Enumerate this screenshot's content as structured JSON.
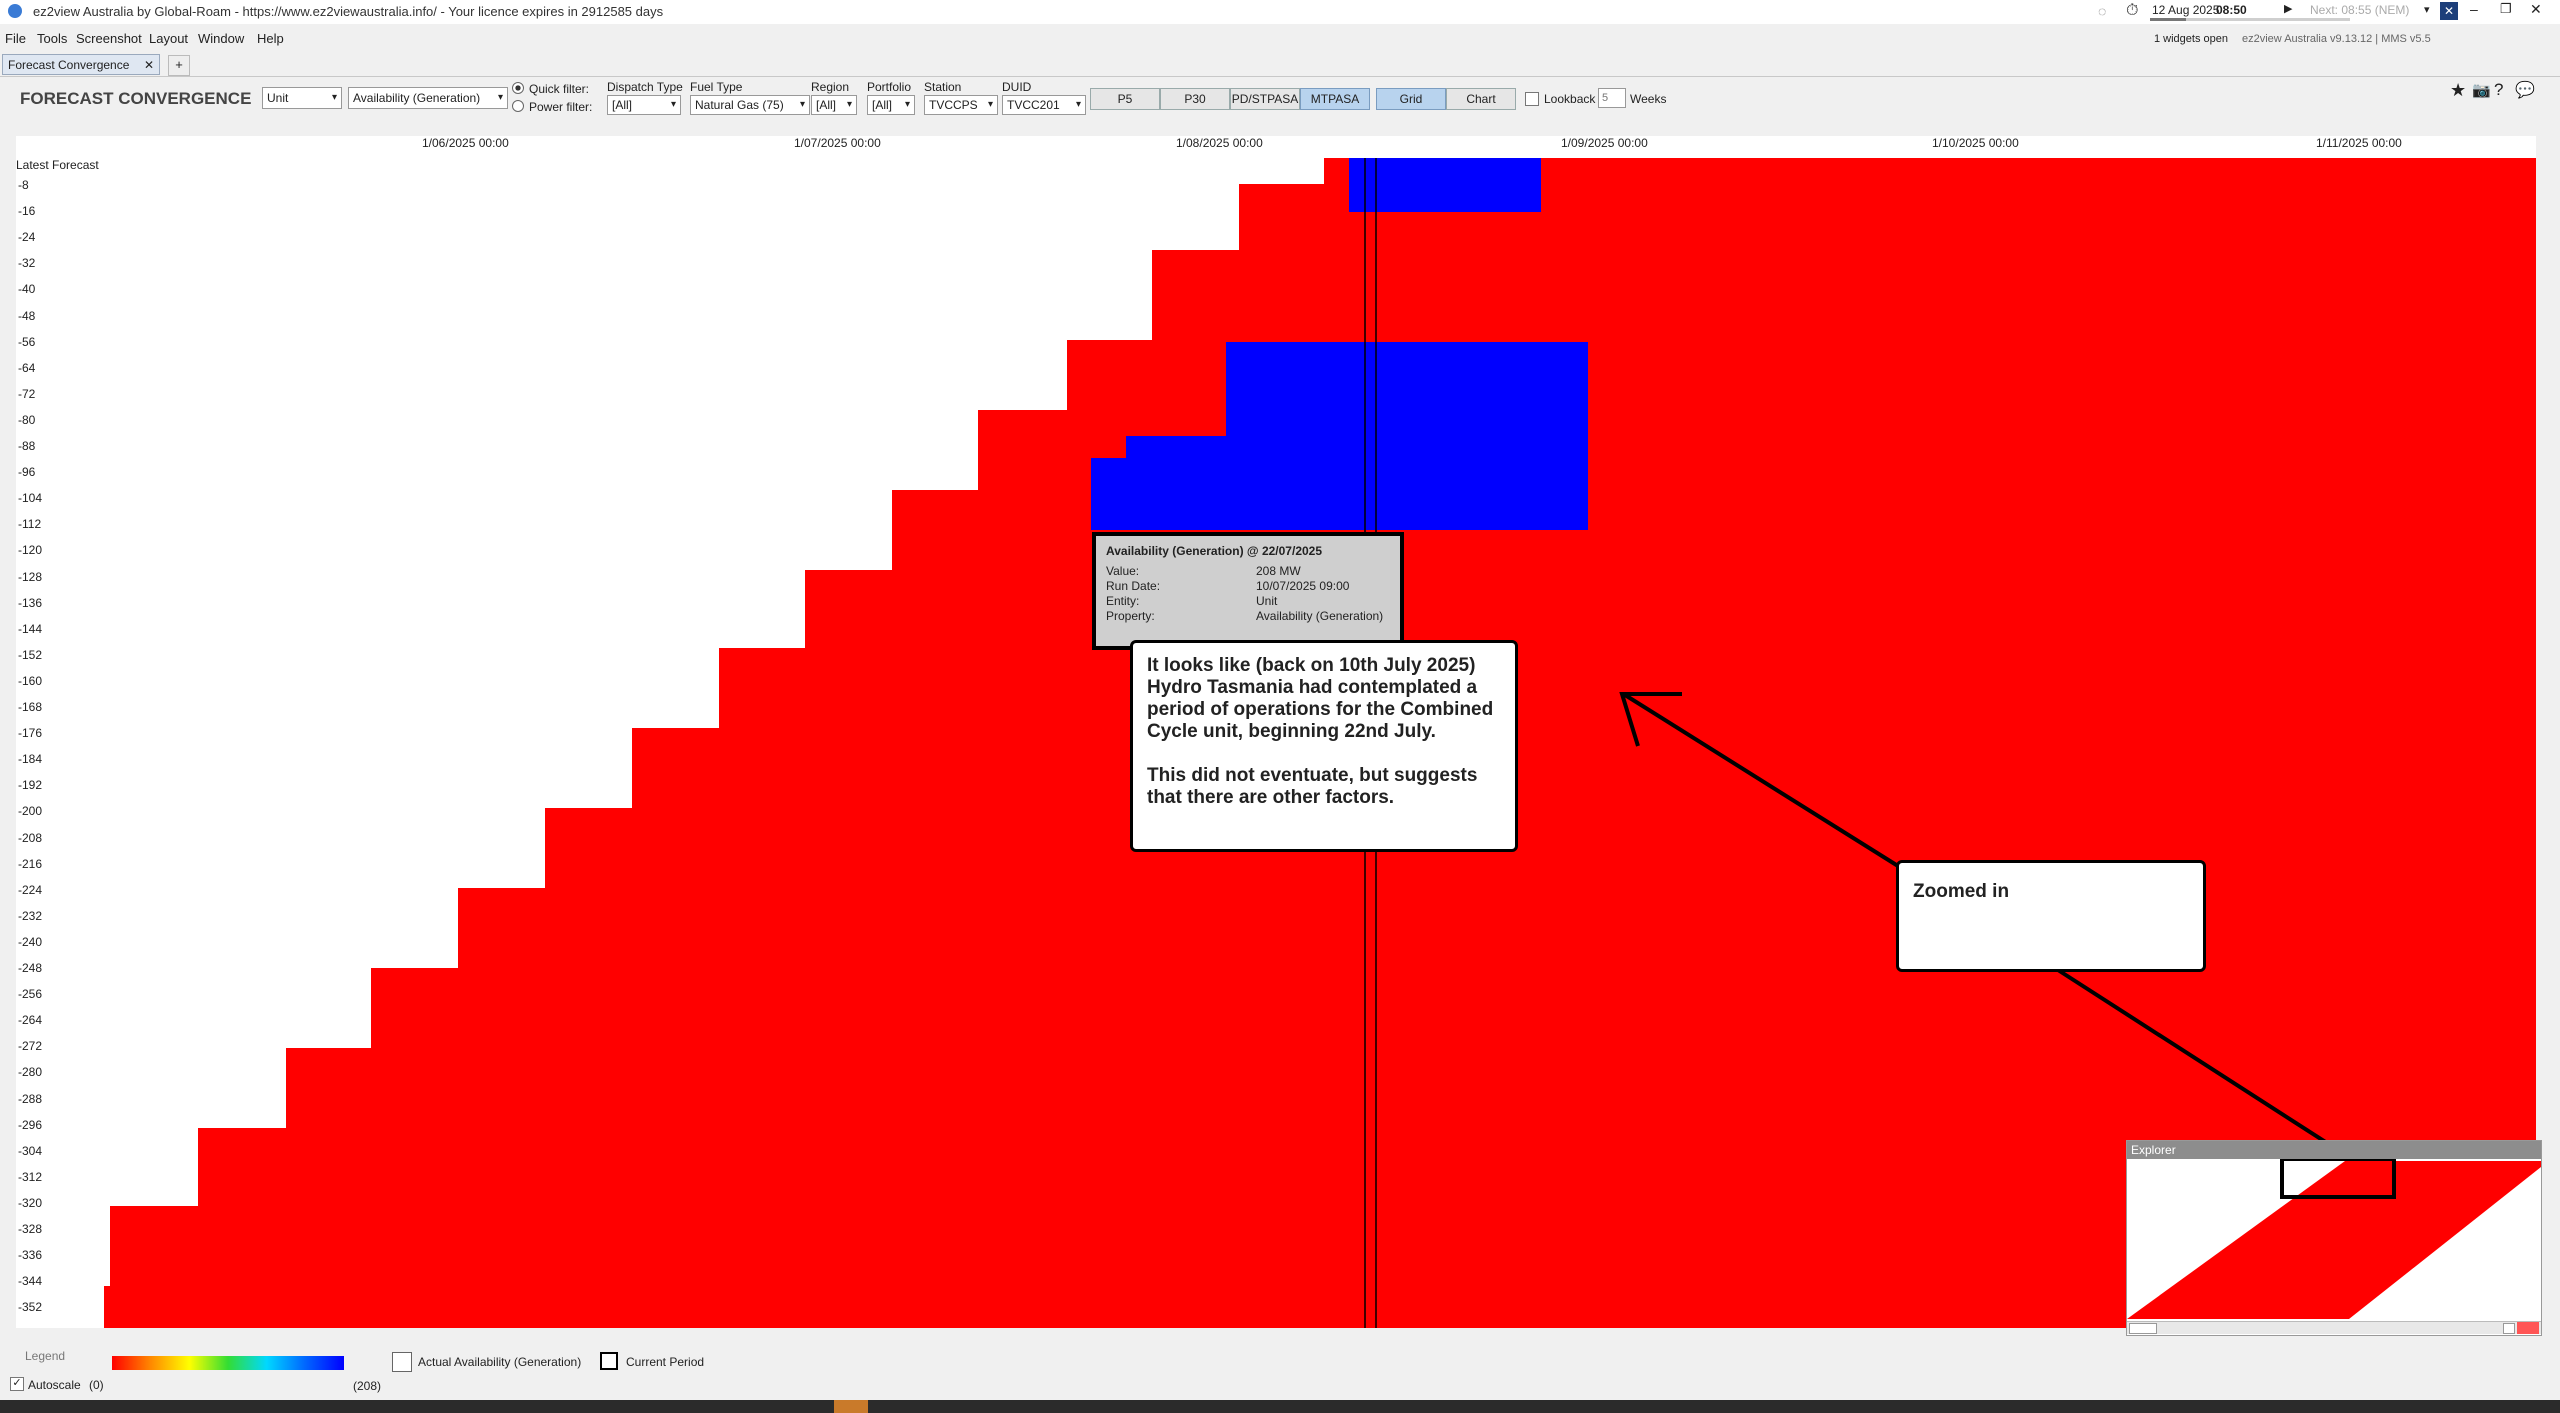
{
  "titlebar": {
    "title": "ez2view Australia by Global-Roam - https://www.ez2viewaustralia.info/ - Your licence expires in 2912585 days",
    "date": "12 Aug 2025",
    "time": "08:50",
    "next": "Next: 08:55 (NEM)",
    "widgets_open": "1 widgets open",
    "version": "ez2view Australia v9.13.12 | MMS v5.5"
  },
  "menu": [
    "File",
    "Tools",
    "Screenshot",
    "Layout",
    "Window",
    "Help"
  ],
  "tabs": [
    {
      "label": "Forecast Convergence"
    }
  ],
  "toolbar": {
    "title": "FORECAST CONVERGENCE",
    "unit_select": "Unit",
    "property_select": "Availability (Generation)",
    "quick_filter": "Quick filter:",
    "power_filter": "Power filter:",
    "dispatch_type_label": "Dispatch Type",
    "dispatch_type_value": "[All]",
    "fuel_type_label": "Fuel Type",
    "fuel_type_value": "Natural Gas (75)",
    "region_label": "Region",
    "region_value": "[All]",
    "portfolio_label": "Portfolio",
    "portfolio_value": "[All]",
    "station_label": "Station",
    "station_value": "TVCCPS",
    "duid_label": "DUID",
    "duid_value": "TVCC201",
    "modes": [
      "P5",
      "P30",
      "PD/STPASA",
      "MTPASA"
    ],
    "views": [
      "Grid",
      "Chart"
    ],
    "lookback_label": "Lookback",
    "lookback_value": "5",
    "weeks_label": "Weeks"
  },
  "chart_data": {
    "type": "heatmap",
    "x_tick_labels": [
      "1/06/2025 00:00",
      "1/07/2025 00:00",
      "1/08/2025 00:00",
      "1/09/2025 00:00",
      "1/10/2025 00:00",
      "1/11/2025 00:00"
    ],
    "y_top_label": "Latest Forecast",
    "y_tick_labels": [
      "-8",
      "-16",
      "-24",
      "-32",
      "-40",
      "-48",
      "-56",
      "-64",
      "-72",
      "-80",
      "-88",
      "-96",
      "-104",
      "-112",
      "-120",
      "-128",
      "-136",
      "-144",
      "-152",
      "-160",
      "-168",
      "-176",
      "-184",
      "-192",
      "-200",
      "-208",
      "-216",
      "-224",
      "-232",
      "-240",
      "-248",
      "-256",
      "-264",
      "-272",
      "-280",
      "-288",
      "-296",
      "-304",
      "-312",
      "-320",
      "-328",
      "-336",
      "-344",
      "-352"
    ],
    "color_scale": {
      "min": 0,
      "max": 208,
      "min_color": "#ff0000",
      "max_color": "#0000ff"
    },
    "no_data_color": "#ffffff",
    "value_note": "most cells 0 MW (red); blue region = 208 MW"
  },
  "tooltip": {
    "title": "Availability (Generation) @ 22/07/2025",
    "rows": [
      {
        "k": "Value:",
        "v": "208 MW"
      },
      {
        "k": "Run Date:",
        "v": "10/07/2025 09:00"
      },
      {
        "k": "Entity:",
        "v": "Unit"
      },
      {
        "k": "Property:",
        "v": "Availability (Generation)"
      }
    ]
  },
  "annotations": {
    "callout1_p1": "It looks like (back on 10th July 2025) Hydro Tasmania had contemplated a period of operations for the Combined Cycle unit, beginning 22nd July.",
    "callout1_p2": "This did not eventuate, but suggests that there are other factors.",
    "callout2": "Zoomed in"
  },
  "explorer": {
    "title": "Explorer"
  },
  "legend": {
    "title": "Legend",
    "min": "(0)",
    "max": "(208)",
    "actual": "Actual Availability (Generation)",
    "current": "Current Period",
    "autoscale": "Autoscale"
  }
}
